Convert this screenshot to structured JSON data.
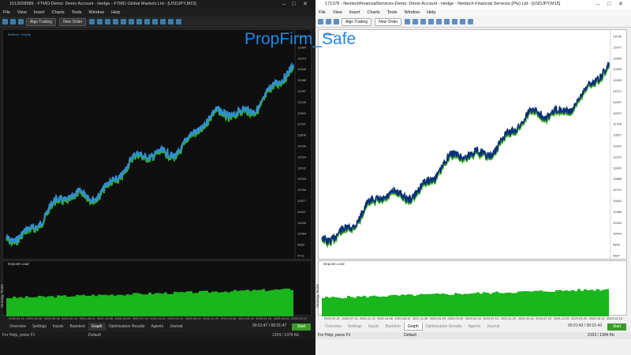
{
  "overlay_title": "PropFirm_Safe",
  "menu_items": [
    "File",
    "View",
    "Insert",
    "Charts",
    "Tools",
    "Window",
    "Help"
  ],
  "toolbar": {
    "algo": "Algo Trading",
    "new_order": "New Order"
  },
  "tabs": [
    "Overview",
    "Settings",
    "Inputs",
    "Backtest",
    "Graph",
    "Optimization Results",
    "Agents",
    "Journal"
  ],
  "left": {
    "title": "1513008989 - FTMO-Demo: Demo Account - Hedge - FTMO Global Markets Ltd - [USDJPY,M15]",
    "legend": "Balance / Equity",
    "deposit_load": "Deposit Load",
    "y_ticks": [
      "13536",
      "13384",
      "13210",
      "12840",
      "12468",
      "12297",
      "12125",
      "11953",
      "11781",
      "11608",
      "11436",
      "11264",
      "11092",
      "10920",
      "10750",
      "10577",
      "10407",
      "10233",
      "10064",
      "9883",
      "9711"
    ],
    "dates": [
      "2020.01.21",
      "2020.05.19",
      "2020.09.28",
      "2021.02.10",
      "2021.06.21",
      "2021.10.28",
      "2022.03.09",
      "2022.07.18",
      "2022.11.22",
      "2023.04.10",
      "2023.08.15",
      "2023.12.29",
      "2024.05.08",
      "2024.09.18",
      "2025.01.29",
      "2025.06.06",
      "2025.10.21"
    ],
    "timer": "00:01:47 / 00:01:47",
    "start": "Start",
    "status_left": "For Help, press F1",
    "status_mid": "Default",
    "status_right": "1204 / 1979 Kb",
    "strategy_tester": "Strategy Tester"
  },
  "right": {
    "title": "171378 - NeotechFinancialServices-Demo: Demo Account - Hedge - Neotech Financial Services (Pty) Ltd - [USDJPY,M15]",
    "legend": "Balance",
    "deposit_load": "Deposit Load",
    "y_ticks": [
      "13140",
      "12977",
      "12804",
      "12625",
      "12450",
      "12271",
      "12097",
      "11922",
      "11748",
      "11567",
      "11392",
      "11220",
      "11045",
      "10868",
      "10712",
      "10532",
      "10355",
      "10183",
      "10004",
      "9829",
      "9667"
    ],
    "dates": [
      "2020.01.21",
      "2020.07.13",
      "2020.11.13",
      "2021.04.06",
      "2021.08.12",
      "2021.11.08",
      "2022.04.29",
      "2022.09.26",
      "2023.02.16",
      "2023.07.13",
      "2023.11.29",
      "2024.04.16",
      "2024.07.23",
      "2024.12.05",
      "2025.03.20",
      "2025.08.19",
      "2025.12.13"
    ],
    "timer": "00:01:43 / 00:01:43",
    "start": "Start",
    "status_left": "For Help, press F1",
    "status_mid": "Default",
    "status_right": "2153 / 1994 Kb",
    "strategy_tester": "Strategy Tester"
  },
  "colors": {
    "left_balance": "#2f8fd6",
    "left_equity": "#3aa822",
    "right_balance": "#0b2f7a",
    "right_equity": "#3aa822",
    "deposit": "#19b61c"
  }
}
